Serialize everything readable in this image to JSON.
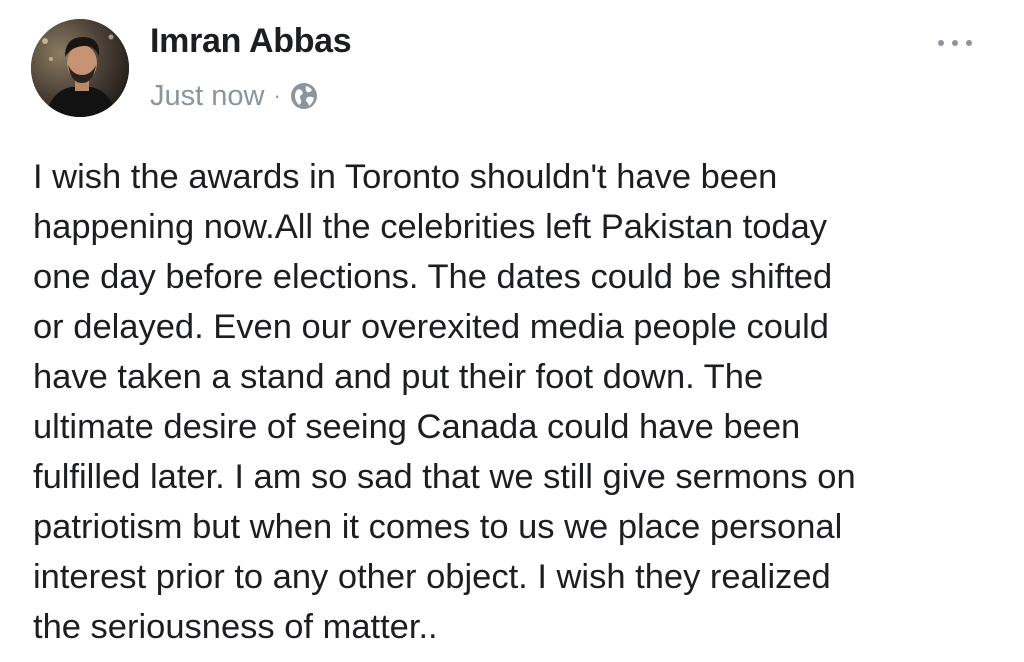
{
  "post": {
    "author": "Imran Abbas",
    "timestamp": "Just now",
    "separator": "·",
    "privacy_icon": "globe-icon",
    "more_icon": "more-options-icon",
    "text": "I wish the awards in Toronto shouldn't have been\nhappening now.All the celebrities left Pakistan today\none day before elections. The dates could be shifted\nor delayed. Even our overexited media people could\nhave taken a stand and put their foot down. The\nultimate desire of seeing Canada could have been\nfulfilled later. I am so sad that we still give sermons on\npatriotism but when it comes to us we place personal\ninterest prior to any other object. I wish they realized\nthe seriousness of matter.."
  },
  "colors": {
    "text": "#1c1e21",
    "meta": "#8d949e",
    "background": "#ffffff"
  }
}
